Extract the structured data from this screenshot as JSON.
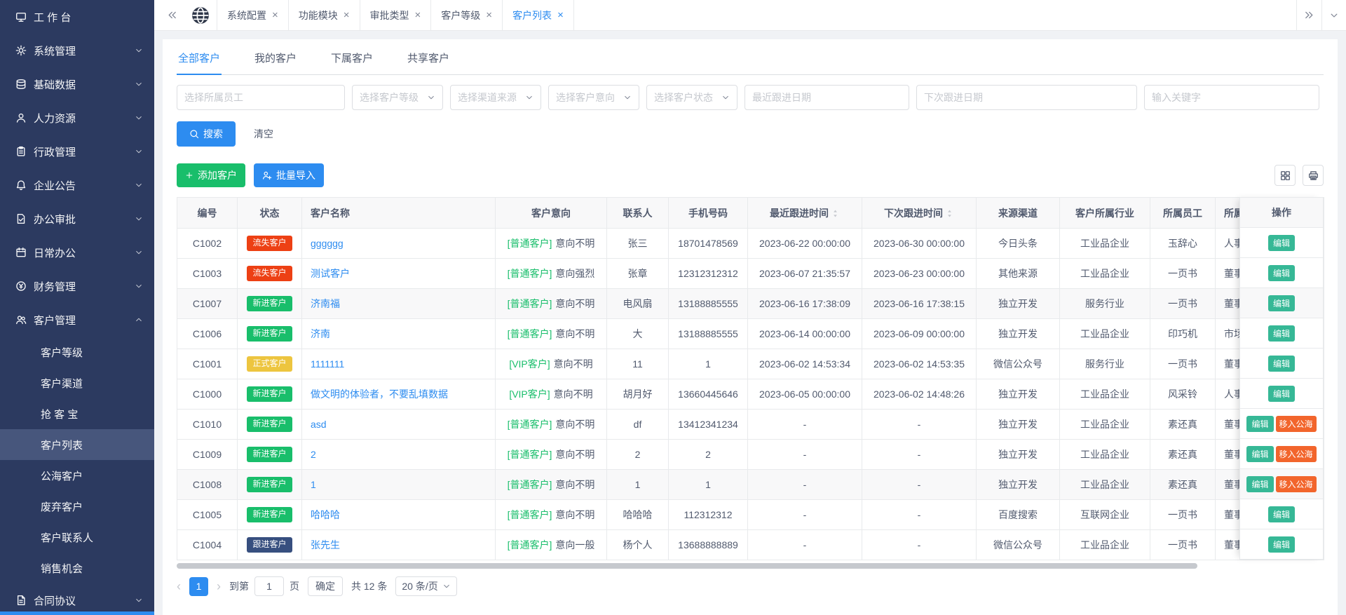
{
  "colors": {
    "primary": "#2d8cf0",
    "success": "#19be6b",
    "lost_badge": "#ed4014",
    "new_badge": "#19be6b",
    "formal_badge": "#edc53f",
    "follow_badge": "#374f7f",
    "edit_button": "#36b896",
    "move_button": "#f2652c",
    "sidebar_bg": "#2c3a60",
    "sidebar_active": "#47567c"
  },
  "sidebar": {
    "items": [
      {
        "label": "工 作 台",
        "icon": "monitor-icon"
      },
      {
        "label": "系统管理",
        "icon": "gear-icon",
        "arrow": "down"
      },
      {
        "label": "基础数据",
        "icon": "database-icon",
        "arrow": "down"
      },
      {
        "label": "人力资源",
        "icon": "user-icon",
        "arrow": "down"
      },
      {
        "label": "行政管理",
        "icon": "clipboard-icon",
        "arrow": "down"
      },
      {
        "label": "企业公告",
        "icon": "bell-icon",
        "arrow": "down"
      },
      {
        "label": "办公审批",
        "icon": "approval-icon",
        "arrow": "down"
      },
      {
        "label": "日常办公",
        "icon": "calendar-icon",
        "arrow": "down"
      },
      {
        "label": "财务管理",
        "icon": "coin-icon",
        "arrow": "down"
      },
      {
        "label": "客户管理",
        "icon": "users-icon",
        "arrow": "up",
        "children": [
          "客户等级",
          "客户渠道",
          "抢 客 宝",
          "客户列表",
          "公海客户",
          "废弃客户",
          "客户联系人",
          "销售机会"
        ],
        "active_child": "客户列表"
      },
      {
        "label": "合同协议",
        "icon": "contract-icon",
        "arrow": "down"
      }
    ]
  },
  "tabbar": {
    "tabs": [
      {
        "label": "系统配置"
      },
      {
        "label": "功能模块"
      },
      {
        "label": "审批类型"
      },
      {
        "label": "客户等级"
      },
      {
        "label": "客户列表",
        "active": true
      }
    ],
    "close_glyph": "×"
  },
  "view_tabs": [
    {
      "label": "全部客户",
      "active": true
    },
    {
      "label": "我的客户"
    },
    {
      "label": "下属客户"
    },
    {
      "label": "共享客户"
    }
  ],
  "filters": [
    {
      "placeholder": "选择所属员工",
      "type": "input"
    },
    {
      "placeholder": "选择客户等级",
      "type": "select"
    },
    {
      "placeholder": "选择渠道来源",
      "type": "select"
    },
    {
      "placeholder": "选择客户意向",
      "type": "select"
    },
    {
      "placeholder": "选择客户状态",
      "type": "select"
    },
    {
      "placeholder": "最近跟进日期",
      "type": "date"
    },
    {
      "placeholder": "下次跟进日期",
      "type": "date"
    },
    {
      "placeholder": "输入关键字",
      "type": "input"
    }
  ],
  "actions": {
    "search": "搜索",
    "clear": "清空",
    "add_customer": "添加客户",
    "batch_import": "批量导入"
  },
  "table": {
    "columns": [
      {
        "label": "编号"
      },
      {
        "label": "状态"
      },
      {
        "label": "客户名称"
      },
      {
        "label": "客户意向"
      },
      {
        "label": "联系人"
      },
      {
        "label": "手机号码"
      },
      {
        "label": "最近跟进时间",
        "sortable": true
      },
      {
        "label": "下次跟进时间",
        "sortable": true
      },
      {
        "label": "来源渠道"
      },
      {
        "label": "客户所属行业"
      },
      {
        "label": "所属员工"
      },
      {
        "label": "所属部门"
      },
      {
        "label": "操作"
      }
    ],
    "rows": [
      {
        "id": "C1002",
        "status": "流失客户",
        "status_type": "lost",
        "name": "gggggg",
        "level": "[普通客户]",
        "intent": "意向不明",
        "contact": "张三",
        "phone": "18701478569",
        "last_follow": "2023-06-22 00:00:00",
        "next_follow": "2023-06-30 00:00:00",
        "channel": "今日头条",
        "industry": "工业品企业",
        "employee": "玉辞心",
        "department": "人事",
        "ops": [
          "编辑"
        ]
      },
      {
        "id": "C1003",
        "status": "流失客户",
        "status_type": "lost",
        "name": "测试客户",
        "level": "[普通客户]",
        "intent": "意向强烈",
        "contact": "张章",
        "phone": "12312312312",
        "last_follow": "2023-06-07 21:35:57",
        "next_follow": "2023-06-23 00:00:00",
        "channel": "其他来源",
        "industry": "工业品企业",
        "employee": "一页书",
        "department": "董事",
        "ops": [
          "编辑"
        ]
      },
      {
        "id": "C1007",
        "status": "新进客户",
        "status_type": "new",
        "name": "济南福",
        "level": "[普通客户]",
        "intent": "意向不明",
        "contact": "电风扇",
        "phone": "13188885555",
        "last_follow": "2023-06-16 17:38:09",
        "next_follow": "2023-06-16 17:38:15",
        "channel": "独立开发",
        "industry": "服务行业",
        "employee": "一页书",
        "department": "董事",
        "striped": true,
        "ops": [
          "编辑"
        ]
      },
      {
        "id": "C1006",
        "status": "新进客户",
        "status_type": "new",
        "name": "济南",
        "level": "[普通客户]",
        "intent": "意向不明",
        "contact": "大",
        "phone": "13188885555",
        "last_follow": "2023-06-14 00:00:00",
        "next_follow": "2023-06-09 00:00:00",
        "channel": "独立开发",
        "industry": "工业品企业",
        "employee": "印巧机",
        "department": "市场",
        "ops": [
          "编辑"
        ]
      },
      {
        "id": "C1001",
        "status": "正式客户",
        "status_type": "formal",
        "name": "1111111",
        "level": "[VIP客户]",
        "intent": "意向不明",
        "contact": "11",
        "phone": "1",
        "last_follow": "2023-06-02 14:53:34",
        "next_follow": "2023-06-02 14:53:35",
        "channel": "微信公众号",
        "industry": "服务行业",
        "employee": "一页书",
        "department": "董事",
        "ops": [
          "编辑"
        ]
      },
      {
        "id": "C1000",
        "status": "新进客户",
        "status_type": "new",
        "name": "做文明的体验者，不要乱填数据",
        "level": "[VIP客户]",
        "intent": "意向不明",
        "contact": "胡月好",
        "phone": "13660445646",
        "last_follow": "2023-06-05 00:00:00",
        "next_follow": "2023-06-02 14:48:26",
        "channel": "独立开发",
        "industry": "工业品企业",
        "employee": "风采铃",
        "department": "人事",
        "ops": [
          "编辑"
        ]
      },
      {
        "id": "C1010",
        "status": "新进客户",
        "status_type": "new",
        "name": "asd",
        "level": "[普通客户]",
        "intent": "意向不明",
        "contact": "df",
        "phone": "13412341234",
        "last_follow": "-",
        "next_follow": "-",
        "channel": "独立开发",
        "industry": "工业品企业",
        "employee": "素还真",
        "department": "董事",
        "ops": [
          "编辑",
          "移入公海"
        ]
      },
      {
        "id": "C1009",
        "status": "新进客户",
        "status_type": "new",
        "name": "2",
        "level": "[普通客户]",
        "intent": "意向不明",
        "contact": "2",
        "phone": "2",
        "last_follow": "-",
        "next_follow": "-",
        "channel": "独立开发",
        "industry": "工业品企业",
        "employee": "素还真",
        "department": "董事",
        "ops": [
          "编辑",
          "移入公海"
        ]
      },
      {
        "id": "C1008",
        "status": "新进客户",
        "status_type": "new",
        "name": "1",
        "level": "[普通客户]",
        "intent": "意向不明",
        "contact": "1",
        "phone": "1",
        "last_follow": "-",
        "next_follow": "-",
        "channel": "独立开发",
        "industry": "工业品企业",
        "employee": "素还真",
        "department": "董事",
        "striped": true,
        "ops": [
          "编辑",
          "移入公海"
        ]
      },
      {
        "id": "C1005",
        "status": "新进客户",
        "status_type": "new",
        "name": "哈哈哈",
        "level": "[普通客户]",
        "intent": "意向不明",
        "contact": "哈哈哈",
        "phone": "112312312",
        "last_follow": "-",
        "next_follow": "-",
        "channel": "百度搜索",
        "industry": "互联网企业",
        "employee": "一页书",
        "department": "董事",
        "ops": [
          "编辑"
        ]
      },
      {
        "id": "C1004",
        "status": "跟进客户",
        "status_type": "follow",
        "name": "张先生",
        "level": "[普通客户]",
        "intent": "意向一般",
        "contact": "杨个人",
        "phone": "13688888889",
        "last_follow": "-",
        "next_follow": "-",
        "channel": "微信公众号",
        "industry": "工业品企业",
        "employee": "一页书",
        "department": "董事",
        "ops": [
          "编辑"
        ]
      }
    ]
  },
  "pagination": {
    "prev_icon": "‹",
    "current_page": "1",
    "next_icon": "›",
    "goto_label": "到第",
    "goto_value": "1",
    "page_label": "页",
    "confirm": "确定",
    "total": "共 12 条",
    "page_size": "20 条/页"
  }
}
